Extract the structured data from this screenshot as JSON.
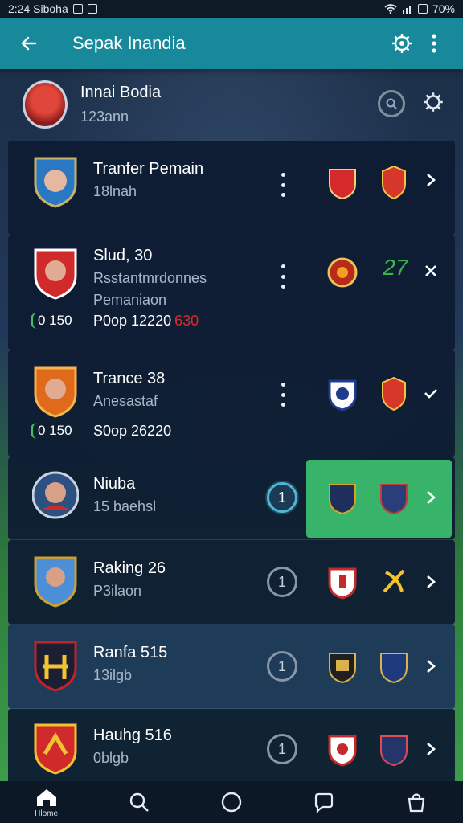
{
  "status_bar": {
    "time_text": "2:24 Siboha",
    "battery_text": "70%"
  },
  "app_bar": {
    "title": "Sepak Inandia",
    "back_icon": "arrow-left-icon",
    "settings_icon": "gear-icon",
    "more_icon": "more-vertical-icon"
  },
  "header": {
    "name": "Innai Bodia",
    "subtitle": "123ann"
  },
  "rows": [
    {
      "name": "Tranfer Pemain",
      "subtitle": "18lnah",
      "action": "chevron-right"
    },
    {
      "name": "Slud, 30",
      "subtitle": "Rsstantmrdonnes",
      "subtitle2": "Pemaniaon",
      "pill": "0 150",
      "extra": "P0op 12220",
      "extra_red": "630",
      "badge2_text": "27",
      "action": "close"
    },
    {
      "name": "Trance 38",
      "subtitle": "Anesastaf",
      "pill": "0 150",
      "extra": "S0op 26220",
      "action": "check"
    },
    {
      "name": "Niuba",
      "subtitle": "15 baehsl",
      "num": "1",
      "action": "chevron-right"
    },
    {
      "name": "Raking 26",
      "subtitle": "P3ilaon",
      "num": "1",
      "action": "chevron-right"
    },
    {
      "name": "Ranfa 515",
      "subtitle": "13ilgb",
      "num": "1",
      "action": "chevron-right"
    },
    {
      "name": "Hauhg 516",
      "subtitle": "0blgb",
      "num": "1",
      "action": "chevron-right"
    }
  ],
  "nav": {
    "home_label": "Hlome"
  },
  "colors": {
    "app_bar": "#17899a",
    "highlight": "#37b36a",
    "active_ring": "#4fb7d1",
    "accent_red": "#e02a2a"
  }
}
